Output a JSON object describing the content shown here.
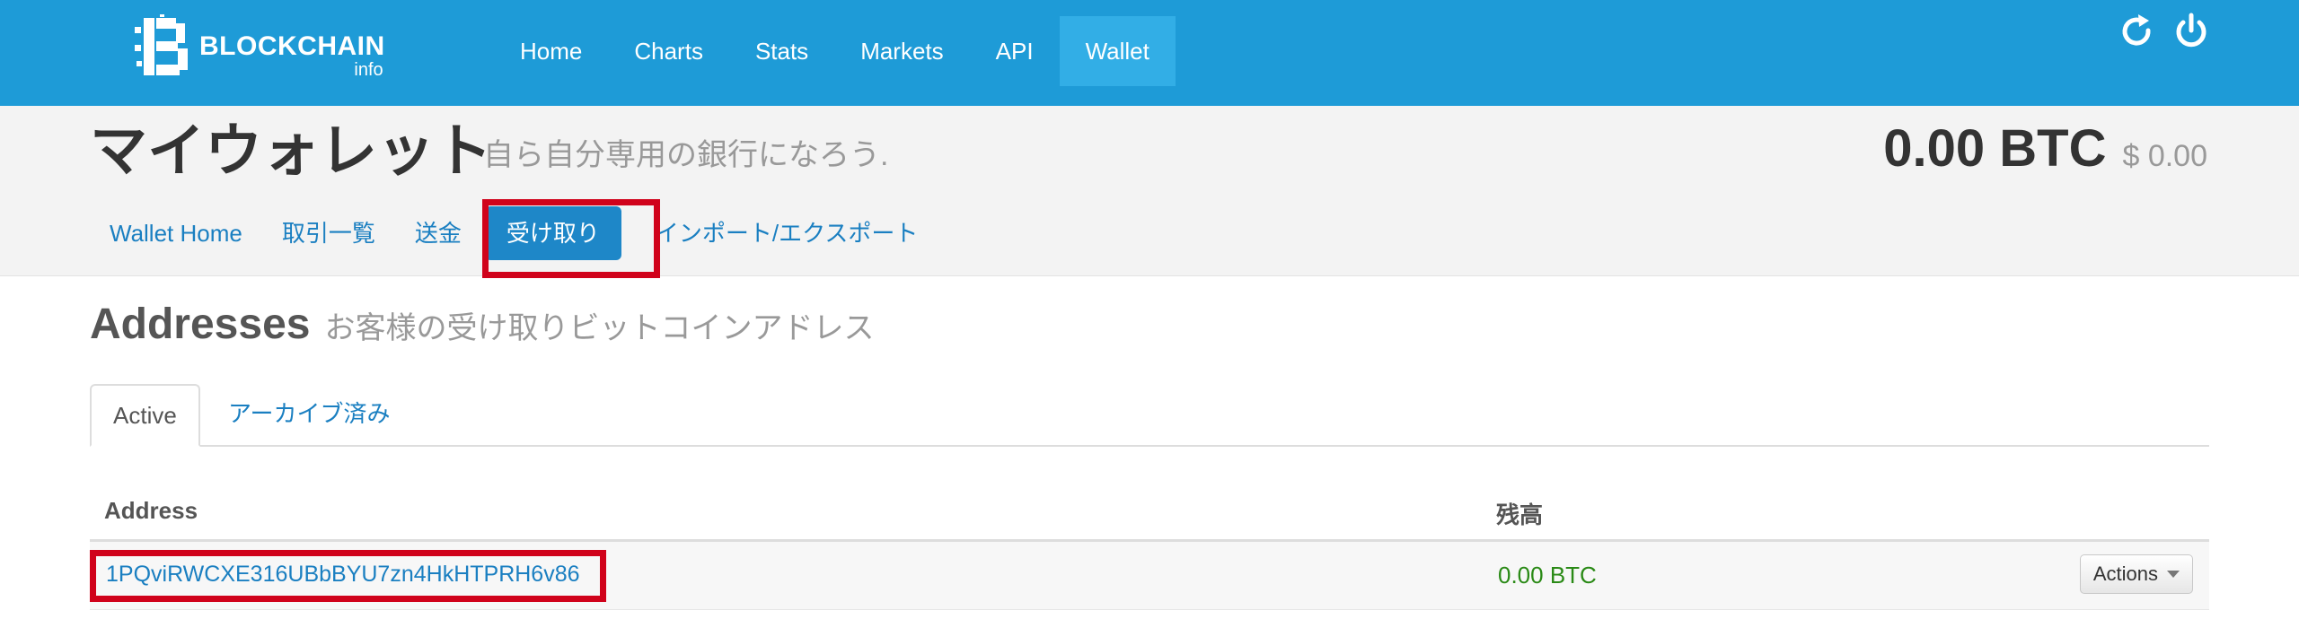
{
  "brand": {
    "name": "BLOCKCHAIN",
    "sub": "info"
  },
  "nav": {
    "items": [
      {
        "label": "Home"
      },
      {
        "label": "Charts"
      },
      {
        "label": "Stats"
      },
      {
        "label": "Markets"
      },
      {
        "label": "API"
      },
      {
        "label": "Wallet"
      }
    ],
    "active": "Wallet"
  },
  "wallet": {
    "title": "マイウォレット",
    "subtitle": "自ら自分専用の銀行になろう.",
    "balance_btc": "0.00 BTC",
    "balance_usd": "$ 0.00"
  },
  "subnav": {
    "items": [
      {
        "label": "Wallet Home"
      },
      {
        "label": "取引一覧"
      },
      {
        "label": "送金"
      },
      {
        "label": "受け取り"
      },
      {
        "label": "インポート/エクスポート"
      }
    ],
    "active": "受け取り"
  },
  "section": {
    "title": "Addresses",
    "subtitle": "お客様の受け取りビットコインアドレス"
  },
  "tabs": {
    "active": "Active",
    "other": "アーカイブ済み"
  },
  "table": {
    "headers": {
      "address": "Address",
      "balance": "残高"
    },
    "rows": [
      {
        "address": "1PQviRWCXE316UBbBYU7zn4HkHTPRH6v86",
        "balance": "0.00 BTC",
        "action": "Actions"
      }
    ]
  },
  "colors": {
    "header_bg": "#1e9bd7",
    "highlight": "#d0021b",
    "link": "#1a7fc1",
    "positive": "#2a8a16"
  },
  "icons": {
    "refresh": "refresh-icon",
    "power": "power-icon"
  }
}
